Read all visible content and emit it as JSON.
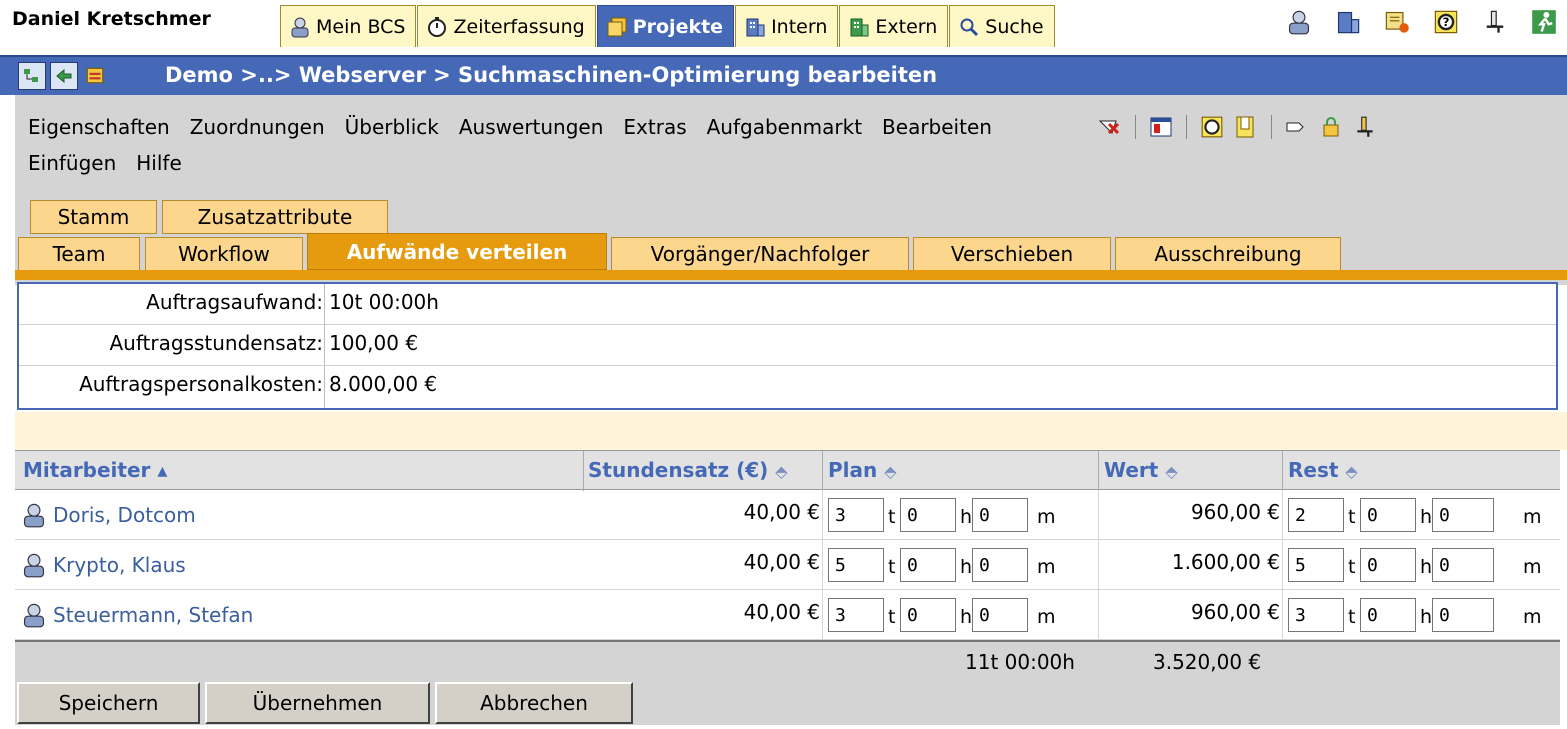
{
  "user": {
    "name": "Daniel Kretschmer"
  },
  "main_tabs": [
    {
      "label": "Mein BCS",
      "icon": "person-icon",
      "active": false
    },
    {
      "label": "Zeiterfassung",
      "icon": "stopwatch-icon",
      "active": false
    },
    {
      "label": "Projekte",
      "icon": "folders-icon",
      "active": true
    },
    {
      "label": "Intern",
      "icon": "building-icon",
      "active": false
    },
    {
      "label": "Extern",
      "icon": "building-green-icon",
      "active": false
    },
    {
      "label": "Suche",
      "icon": "search-icon",
      "active": false
    }
  ],
  "top_icons": [
    "person-icon",
    "building-icon",
    "notes-icon",
    "help-icon",
    "pin-icon",
    "logout-icon"
  ],
  "header": {
    "breadcrumb": "Demo >..> Webserver > Suchmaschinen-Optimierung bearbeiten"
  },
  "menu": {
    "row1": [
      "Eigenschaften",
      "Zuordnungen",
      "Überblick",
      "Auswertungen",
      "Extras",
      "Aufgabenmarkt",
      "Bearbeiten"
    ],
    "row2": [
      "Einfügen",
      "Hilfe"
    ]
  },
  "subtabs": {
    "row1": [
      "Stamm",
      "Zusatzattribute"
    ],
    "row2": [
      "Team",
      "Workflow",
      "Aufwände verteilen",
      "Vorgänger/Nachfolger",
      "Verschieben",
      "Ausschreibung"
    ],
    "active": "Aufwände verteilen"
  },
  "info": {
    "rows": [
      {
        "label": "Auftragsaufwand:",
        "value": "10t 00:00h"
      },
      {
        "label": "Auftragsstundensatz:",
        "value": "100,00 €"
      },
      {
        "label": "Auftragspersonalkosten:",
        "value": "8.000,00 €"
      }
    ]
  },
  "grid": {
    "headers": {
      "employee": "Mitarbeiter ▴",
      "rate": "Stundensatz (€)",
      "plan": "Plan",
      "value": "Wert",
      "rest": "Rest",
      "sort_symbol": "⬘"
    },
    "units": {
      "t": "t",
      "h": "h",
      "m": "m"
    },
    "rows": [
      {
        "name": "Doris, Dotcom",
        "rate": "40,00 €",
        "plan": [
          "3",
          "0",
          "0"
        ],
        "value": "960,00 €",
        "rest": [
          "2",
          "0",
          "0"
        ]
      },
      {
        "name": "Krypto, Klaus",
        "rate": "40,00 €",
        "plan": [
          "5",
          "0",
          "0"
        ],
        "value": "1.600,00 €",
        "rest": [
          "5",
          "0",
          "0"
        ]
      },
      {
        "name": "Steuermann, Stefan",
        "rate": "40,00 €",
        "plan": [
          "3",
          "0",
          "0"
        ],
        "value": "960,00 €",
        "rest": [
          "3",
          "0",
          "0"
        ]
      }
    ],
    "totals": {
      "plan": "11t 00:00h",
      "value": "3.520,00 €"
    }
  },
  "buttons": {
    "save": "Speichern",
    "apply": "Übernehmen",
    "cancel": "Abbrechen"
  },
  "colors": {
    "blue": "#4569b6",
    "orange": "#e69a0d",
    "tab": "#fbd68c",
    "grey": "#d4d4d4"
  }
}
